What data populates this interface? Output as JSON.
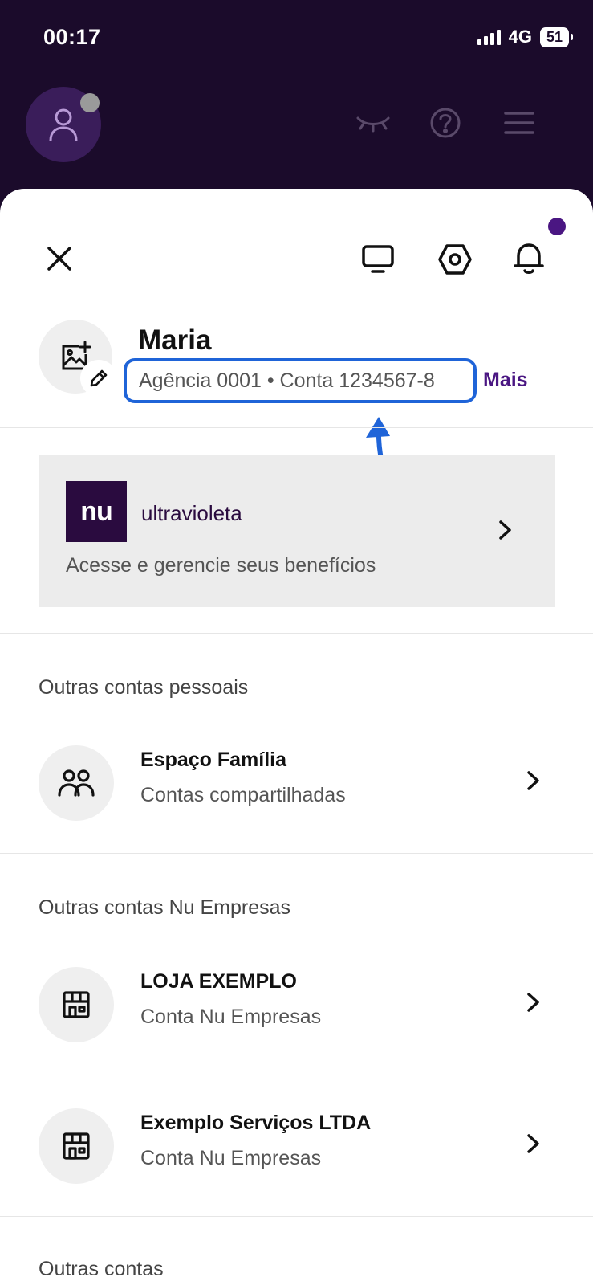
{
  "status_bar": {
    "time": "00:17",
    "network": "4G",
    "battery": "51"
  },
  "header": {
    "icons": [
      "profile-icon",
      "eye-closed-icon",
      "help-icon",
      "menu-icon"
    ]
  },
  "sheet": {
    "toolbar_icons": [
      "close-icon",
      "monitor-icon",
      "settings-hex-icon",
      "bell-icon"
    ],
    "profile": {
      "name": "Maria",
      "account_line": "Agência 0001 • Conta 1234567-8",
      "more_link": "Mais"
    },
    "ultravioleta_card": {
      "logo_text": "nu",
      "name": "ultravioleta",
      "description": "Acesse e gerencie seus benefícios"
    },
    "sections": [
      {
        "title": "Outras contas pessoais",
        "items": [
          {
            "title": "Espaço Família",
            "subtitle": "Contas compartilhadas",
            "icon": "people-icon"
          }
        ]
      },
      {
        "title": "Outras contas Nu Empresas",
        "items": [
          {
            "title": "LOJA EXEMPLO",
            "subtitle": "Conta Nu Empresas",
            "icon": "store-icon"
          },
          {
            "title": "Exemplo Serviços LTDA",
            "subtitle": "Conta Nu Empresas",
            "icon": "store-icon"
          }
        ]
      },
      {
        "title": "Outras contas",
        "items": []
      }
    ]
  },
  "colors": {
    "brand_purple": "#4a1682",
    "header_bg": "#1b0b2b",
    "annotation_blue": "#1f64d8"
  }
}
